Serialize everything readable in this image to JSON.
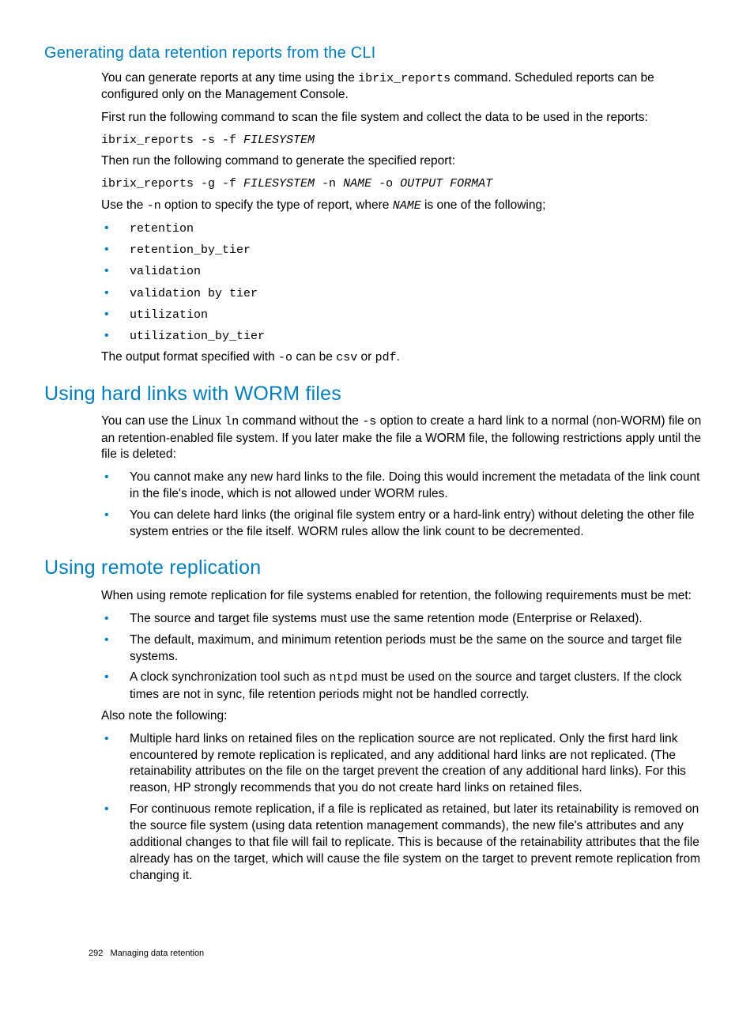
{
  "sec1": {
    "title": "Generating data retention reports from the CLI",
    "p1_a": "You can generate reports at any time using the ",
    "p1_code": "ibrix_reports",
    "p1_b": " command. Scheduled reports can be configured only on the Management Console.",
    "p2": "First run the following command to scan the file system and collect the data to be used in the reports:",
    "cmd1_a": "ibrix_reports -s -f ",
    "cmd1_i": "FILESYSTEM",
    "p3": "Then run the following command to generate the specified report:",
    "cmd2_a": "ibrix_reports -g -f ",
    "cmd2_i1": "FILESYSTEM",
    "cmd2_b": " -n ",
    "cmd2_i2": "NAME",
    "cmd2_c": " -o ",
    "cmd2_i3": "OUTPUT FORMAT",
    "p4_a": "Use the ",
    "p4_code1": "-n",
    "p4_b": " option to specify the type of report, where ",
    "p4_code2": "NAME",
    "p4_c": " is one of the following;",
    "items": [
      "retention",
      "retention_by_tier",
      "validation",
      "validation by tier",
      "utilization",
      "utilization_by_tier"
    ],
    "p5_a": "The output format specified with ",
    "p5_code1": "-o",
    "p5_b": " can be ",
    "p5_code2": "csv",
    "p5_c": " or ",
    "p5_code3": "pdf",
    "p5_d": "."
  },
  "sec2": {
    "title": "Using hard links with WORM files",
    "p1_a": "You can use the Linux ",
    "p1_code1": "ln",
    "p1_b": " command without the ",
    "p1_code2": "-s",
    "p1_c": " option to create a hard link to a normal (non-WORM) file on an retention-enabled file system. If you later make the file a WORM file, the following restrictions apply until the file is deleted:",
    "items": [
      "You cannot make any new hard links to the file. Doing this would increment the metadata of the link count in the file's inode, which is not allowed under WORM rules.",
      "You can delete hard links (the original file system entry or a hard-link entry) without deleting the other file system entries or the file itself. WORM rules allow the link count to be decremented."
    ]
  },
  "sec3": {
    "title": "Using remote replication",
    "p1": "When using remote replication for file systems enabled for retention, the following requirements must be met:",
    "items1": {
      "a": "The source and target file systems must use the same retention mode (Enterprise or Relaxed).",
      "b": "The default, maximum, and minimum retention periods must be the same on the source and target file systems.",
      "c_a": "A clock synchronization tool such as ",
      "c_code": "ntpd",
      "c_b": " must be used on the source and target clusters. If the clock times are not in sync, file retention periods might not be handled correctly."
    },
    "p2": "Also note the following:",
    "items2": [
      "Multiple hard links on retained files on the replication source are not replicated. Only the first hard link encountered by remote replication is replicated, and any additional hard links are not replicated. (The retainability attributes on the file on the target prevent the creation of any additional hard links). For this reason, HP strongly recommends that you do not create hard links on retained files.",
      "For continuous remote replication, if a file is replicated as retained, but later its retainability is removed on the source file system (using data retention management commands), the new file's attributes and any additional changes to that file will fail to replicate. This is because of the retainability attributes that the file already has on the target, which will cause the file system on the target to prevent remote replication from changing it."
    ]
  },
  "footer": {
    "page": "292",
    "chapter": "Managing data retention"
  }
}
